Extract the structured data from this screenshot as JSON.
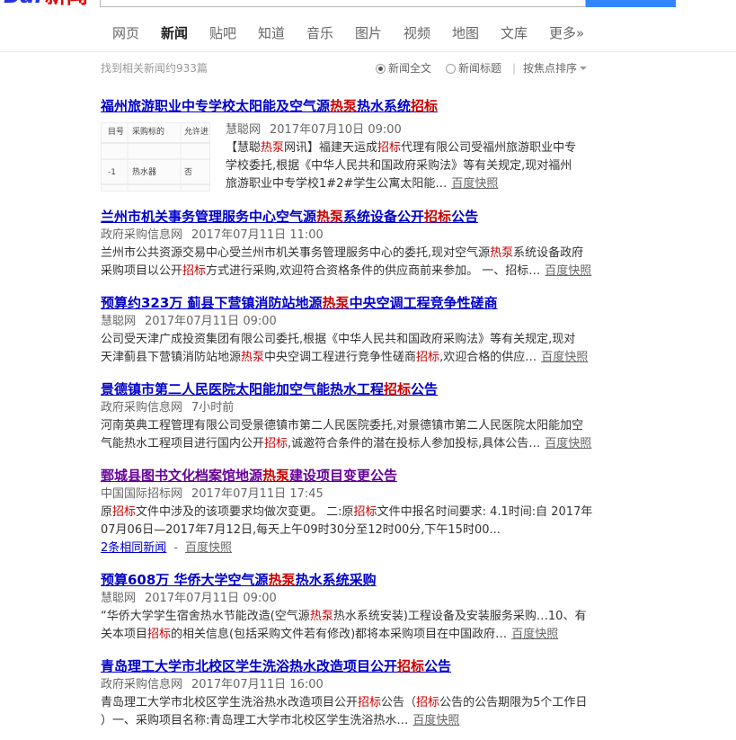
{
  "logo": {
    "text_blue": "Bai",
    "text_red": "新闻"
  },
  "colors": {
    "brand_blue": "#2932e1",
    "brand_red": "#e10601",
    "search_button": "#3385ff",
    "title_link": "#0000cc",
    "title_visited": "#660099",
    "highlight": "#cc0000"
  },
  "nav": {
    "tabs": [
      {
        "label": "网页",
        "active": false
      },
      {
        "label": "新闻",
        "active": true
      },
      {
        "label": "贴吧",
        "active": false
      },
      {
        "label": "知道",
        "active": false
      },
      {
        "label": "音乐",
        "active": false
      },
      {
        "label": "图片",
        "active": false
      },
      {
        "label": "视频",
        "active": false
      },
      {
        "label": "地图",
        "active": false
      },
      {
        "label": "文库",
        "active": false
      },
      {
        "label": "更多»",
        "active": false
      }
    ]
  },
  "filters": {
    "result_count": "找到相关新闻约933篇",
    "options": [
      {
        "label": "新闻全文",
        "selected": true
      },
      {
        "label": "新闻标题",
        "selected": false
      }
    ],
    "separator": "|",
    "sort_label": "按焦点排序",
    "sort_icon": "caret-down-icon"
  },
  "results": [
    {
      "title": [
        {
          "text": "福州旅游职业中专学校太阳能及空气源"
        },
        {
          "text": "热泵",
          "em": true
        },
        {
          "text": "热水系统"
        },
        {
          "text": "招标",
          "em": true
        }
      ],
      "visited": false,
      "thumbnail": {
        "rows": [
          [
            "目号",
            "采购标的",
            "允许进"
          ],
          [
            "-1",
            "热水器",
            "否"
          ]
        ]
      },
      "source": "慧聪网",
      "time": "2017年07月10日 09:00",
      "lines": [
        [
          {
            "text": "【慧聪"
          },
          {
            "text": "热泵",
            "em": true
          },
          {
            "text": "网讯】福建天运成"
          },
          {
            "text": "招标",
            "em": true
          },
          {
            "text": "代理有限公司受福州旅游职业中专"
          }
        ],
        [
          {
            "text": "学校委托,根据《中华人民共和国政府采购法》等有关规定,现对福州"
          }
        ],
        [
          {
            "text": "旅游职业中专学校1#2#学生公寓太阳能…"
          }
        ]
      ],
      "cache_label": "百度快照"
    },
    {
      "title": [
        {
          "text": "兰州市机关事务管理服务中心空气源"
        },
        {
          "text": "热泵",
          "em": true
        },
        {
          "text": "系统设备公开"
        },
        {
          "text": "招标",
          "em": true
        },
        {
          "text": "公告"
        }
      ],
      "visited": false,
      "source": "政府采购信息网",
      "time": "2017年07月11日 11:00",
      "lines": [
        [
          {
            "text": "兰州市公共资源交易中心受兰州市机关事务管理服务中心的委托,现对空气源"
          },
          {
            "text": "热泵",
            "em": true
          },
          {
            "text": "系统设备政府"
          }
        ],
        [
          {
            "text": "采购项目以公开"
          },
          {
            "text": "招标",
            "em": true
          },
          {
            "text": "方式进行采购,欢迎符合资格条件的供应商前来参加。 一、招标…"
          }
        ]
      ],
      "cache_label": "百度快照"
    },
    {
      "title": [
        {
          "text": "预算约323万 蓟县下营镇消防站地源"
        },
        {
          "text": "热泵",
          "em": true
        },
        {
          "text": "中央空调工程竞争性磋商"
        }
      ],
      "visited": false,
      "source": "慧聪网",
      "time": "2017年07月11日 09:00",
      "lines": [
        [
          {
            "text": "公司受天津广成投资集团有限公司委托,根据《中华人民共和国政府采购法》等有关规定,现对"
          }
        ],
        [
          {
            "text": "天津蓟县下营镇消防站地源"
          },
          {
            "text": "热泵",
            "em": true
          },
          {
            "text": "中央空调工程进行竞争性磋商"
          },
          {
            "text": "招标",
            "em": true
          },
          {
            "text": ",欢迎合格的供应…"
          }
        ]
      ],
      "cache_label": "百度快照"
    },
    {
      "title": [
        {
          "text": "景德镇市第二人民医院太阳能加空气能热水工程"
        },
        {
          "text": "招标",
          "em": true
        },
        {
          "text": "公告"
        }
      ],
      "visited": false,
      "source": "政府采购信息网",
      "time": "7小时前",
      "lines": [
        [
          {
            "text": "河南英典工程管理有限公司受景德镇市第二人民医院委托,对景德镇市第二人民医院太阳能加空"
          }
        ],
        [
          {
            "text": "气能热水工程项目进行国内公开"
          },
          {
            "text": "招标",
            "em": true
          },
          {
            "text": ",诚邀符合条件的潜在投标人参加投标,具体公告…"
          }
        ]
      ],
      "cache_label": "百度快照"
    },
    {
      "title": [
        {
          "text": "鄄城县图书文化档案馆地源"
        },
        {
          "text": "热泵",
          "em": true
        },
        {
          "text": "建设项目变更公告"
        }
      ],
      "visited": true,
      "source": "中国国际招标网",
      "time": "2017年07月11日 17:45",
      "lines": [
        [
          {
            "text": "原"
          },
          {
            "text": "招标",
            "em": true
          },
          {
            "text": "文件中涉及的该项要求均做次变更。 二:原"
          },
          {
            "text": "招标",
            "em": true
          },
          {
            "text": "文件中报名时间要求: 4.1时间:自 2017年"
          }
        ],
        [
          {
            "text": "07月06日—2017年7月12日,每天上午09时30分至12时00分,下午15时00..."
          }
        ]
      ],
      "related": {
        "label": "2条相同新闻",
        "separator": "-"
      },
      "cache_label": "百度快照"
    },
    {
      "title": [
        {
          "text": "预算608万 华侨大学空气源"
        },
        {
          "text": "热泵",
          "em": true
        },
        {
          "text": "热水系统采购"
        }
      ],
      "visited": false,
      "source": "慧聪网",
      "time": "2017年07月11日 09:00",
      "lines": [
        [
          {
            "text": "“华侨大学学生宿舍热水节能改造(空气源"
          },
          {
            "text": "热泵",
            "em": true
          },
          {
            "text": "热水系统安装)工程设备及安装服务采购…10、有"
          }
        ],
        [
          {
            "text": "关本项目"
          },
          {
            "text": "招标",
            "em": true
          },
          {
            "text": "的相关信息(包括采购文件若有修改)都将本采购项目在中国政府…"
          }
        ]
      ],
      "cache_label": "百度快照"
    },
    {
      "title": [
        {
          "text": "青岛理工大学市北校区学生洗浴热水改造项目公开"
        },
        {
          "text": "招标",
          "em": true
        },
        {
          "text": "公告"
        }
      ],
      "visited": false,
      "source": "政府采购信息网",
      "time": "2017年07月11日 16:00",
      "lines": [
        [
          {
            "text": "青岛理工大学市北校区学生洗浴热水改造项目公开"
          },
          {
            "text": "招标",
            "em": true
          },
          {
            "text": "公告（"
          },
          {
            "text": "招标",
            "em": true
          },
          {
            "text": "公告的公告期限为5个工作日"
          }
        ],
        [
          {
            "text": "）一、采购项目名称:青岛理工大学市北校区学生洗浴热水…"
          }
        ]
      ],
      "cache_label": "百度快照"
    }
  ]
}
